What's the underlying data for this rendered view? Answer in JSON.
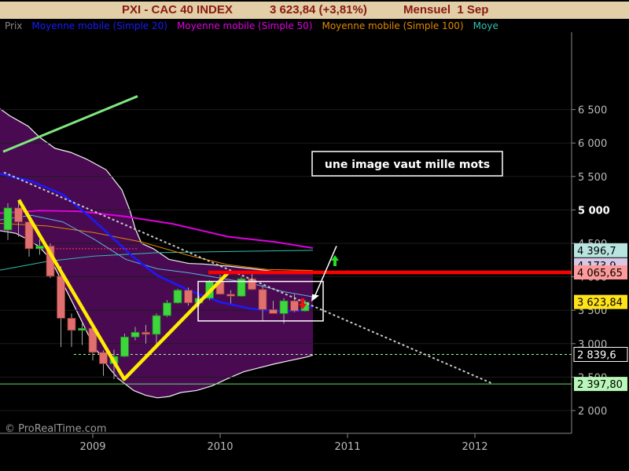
{
  "title": {
    "instrument": "PXI - CAC 40 INDEX",
    "quote": "3 623,84 (+3,81%)",
    "period": "Mensuel  1 Sep"
  },
  "legend": [
    {
      "label": "Prix",
      "color": "#888888"
    },
    {
      "label": "Moyenne mobile (Simple 20)",
      "color": "#1a1aff"
    },
    {
      "label": "Moyenne mobile (Simple 50)",
      "color": "#e000e0"
    },
    {
      "label": "Moyenne mobile (Simple 100)",
      "color": "#e08800"
    },
    {
      "label": "Moye",
      "color": "#30c0b0"
    }
  ],
  "annotation": "une image vaut mille mots",
  "watermark": "© ProRealTime.com",
  "price_labels": [
    {
      "text": "4 396,7",
      "value": 4396.7,
      "color": "#b9e5e0"
    },
    {
      "text": "4 173,9",
      "value": 4173.9,
      "color": "#d8c8e8"
    },
    {
      "text": "4 065,65",
      "value": 4065.65,
      "color": "#ff9a9a"
    },
    {
      "text": "3 623,84",
      "value": 3623.84,
      "color": "#ffe31a"
    },
    {
      "text": "2 839,6",
      "value": 2839.6,
      "color": "#ffffff"
    },
    {
      "text": "2 397,80",
      "value": 2397.8,
      "color": "#b8f7b8"
    }
  ],
  "chart_data": {
    "type": "candlestick",
    "ylim": [
      1800,
      6700
    ],
    "y_ticks": [
      2000,
      2500,
      3000,
      3500,
      4000,
      4500,
      5000,
      5500,
      6000,
      6500
    ],
    "y_tick_labels": [
      "2 000",
      "2 500",
      "3 000",
      "3 500",
      "4 000",
      "4 500",
      "5 000",
      "5 500",
      "6 000",
      "6 500"
    ],
    "x_ticks": [
      2009,
      2010,
      2011,
      2012
    ],
    "x_tick_labels": [
      "2009",
      "2010",
      "2011",
      "2012"
    ],
    "candles": [
      {
        "date": "2008-05",
        "o": 4700,
        "h": 5100,
        "l": 4550,
        "c": 5030
      },
      {
        "date": "2008-06",
        "o": 5030,
        "h": 5120,
        "l": 4600,
        "c": 4820
      },
      {
        "date": "2008-07",
        "o": 4820,
        "h": 4900,
        "l": 4300,
        "c": 4420
      },
      {
        "date": "2008-08",
        "o": 4420,
        "h": 4560,
        "l": 4330,
        "c": 4460
      },
      {
        "date": "2008-09",
        "o": 4460,
        "h": 4500,
        "l": 3980,
        "c": 4010
      },
      {
        "date": "2008-10",
        "o": 4010,
        "h": 4160,
        "l": 2950,
        "c": 3380
      },
      {
        "date": "2008-11",
        "o": 3380,
        "h": 3450,
        "l": 2950,
        "c": 3200
      },
      {
        "date": "2008-12",
        "o": 3200,
        "h": 3300,
        "l": 2980,
        "c": 3230
      },
      {
        "date": "2009-01",
        "o": 3230,
        "h": 3260,
        "l": 2750,
        "c": 2870
      },
      {
        "date": "2009-02",
        "o": 2870,
        "h": 2900,
        "l": 2520,
        "c": 2700
      },
      {
        "date": "2009-03",
        "o": 2700,
        "h": 2910,
        "l": 2470,
        "c": 2810
      },
      {
        "date": "2009-04",
        "o": 2810,
        "h": 3150,
        "l": 2800,
        "c": 3100
      },
      {
        "date": "2009-05",
        "o": 3100,
        "h": 3250,
        "l": 3050,
        "c": 3170
      },
      {
        "date": "2009-06",
        "o": 3170,
        "h": 3280,
        "l": 3000,
        "c": 3140
      },
      {
        "date": "2009-07",
        "o": 3140,
        "h": 3450,
        "l": 2990,
        "c": 3420
      },
      {
        "date": "2009-08",
        "o": 3420,
        "h": 3650,
        "l": 3400,
        "c": 3610
      },
      {
        "date": "2009-09",
        "o": 3610,
        "h": 3820,
        "l": 3600,
        "c": 3800
      },
      {
        "date": "2009-10",
        "o": 3800,
        "h": 3840,
        "l": 3570,
        "c": 3610
      },
      {
        "date": "2009-11",
        "o": 3610,
        "h": 3720,
        "l": 3560,
        "c": 3680
      },
      {
        "date": "2009-12",
        "o": 3680,
        "h": 3950,
        "l": 3650,
        "c": 3930
      },
      {
        "date": "2010-01",
        "o": 3930,
        "h": 4030,
        "l": 3740,
        "c": 3740
      },
      {
        "date": "2010-02",
        "o": 3740,
        "h": 3800,
        "l": 3600,
        "c": 3710
      },
      {
        "date": "2010-03",
        "o": 3710,
        "h": 4000,
        "l": 3700,
        "c": 3970
      },
      {
        "date": "2010-04",
        "o": 3970,
        "h": 4080,
        "l": 3800,
        "c": 3810
      },
      {
        "date": "2010-05",
        "o": 3810,
        "h": 3880,
        "l": 3340,
        "c": 3510
      },
      {
        "date": "2010-06",
        "o": 3510,
        "h": 3640,
        "l": 3450,
        "c": 3450
      },
      {
        "date": "2010-07",
        "o": 3450,
        "h": 3680,
        "l": 3300,
        "c": 3640
      },
      {
        "date": "2010-08",
        "o": 3640,
        "h": 3740,
        "l": 3470,
        "c": 3490
      },
      {
        "date": "2010-09",
        "o": 3490,
        "h": 3650,
        "l": 3480,
        "c": 3624
      }
    ],
    "series": [
      {
        "name": "Moyenne mobile (Simple 20)",
        "color": "#1a1aff",
        "type": "sma20"
      },
      {
        "name": "Moyenne mobile (Simple 50)",
        "color": "#e000e0",
        "type": "sma50"
      },
      {
        "name": "Moyenne mobile (Simple 100)",
        "color": "#e08800",
        "type": "sma100"
      }
    ],
    "horizontal_levels": [
      {
        "value": 4065.65,
        "color": "#ff0000"
      },
      {
        "value": 2839.6,
        "color": "#90ff90"
      },
      {
        "value": 2397.8,
        "color": "#90ff90"
      }
    ]
  }
}
